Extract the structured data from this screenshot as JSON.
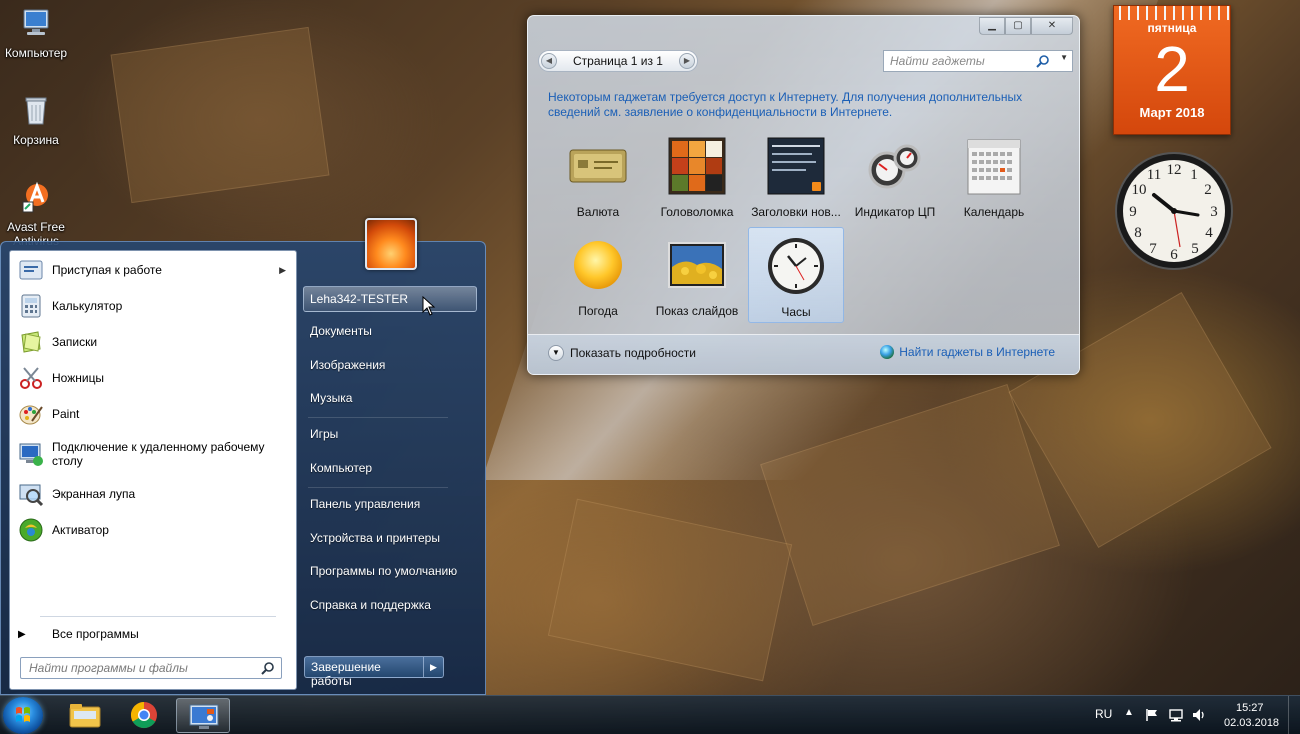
{
  "desktop": {
    "icons": [
      {
        "label": "Компьютер",
        "icon": "computer-icon"
      },
      {
        "label": "Корзина",
        "icon": "recycle-bin-icon"
      },
      {
        "label": "Avast Free Antivirus",
        "icon": "avast-icon"
      }
    ]
  },
  "start_menu": {
    "programs": [
      {
        "label": "Приступая к работе",
        "icon": "getting-started-icon",
        "has_submenu": true
      },
      {
        "label": "Калькулятор",
        "icon": "calculator-icon"
      },
      {
        "label": "Записки",
        "icon": "sticky-notes-icon"
      },
      {
        "label": "Ножницы",
        "icon": "snipping-tool-icon"
      },
      {
        "label": "Paint",
        "icon": "paint-icon"
      },
      {
        "label": "Подключение к удаленному рабочему столу",
        "icon": "remote-desktop-icon"
      },
      {
        "label": "Экранная лупа",
        "icon": "magnifier-icon"
      },
      {
        "label": "Активатор",
        "icon": "activator-icon"
      }
    ],
    "all_programs": "Все программы",
    "search_placeholder": "Найти программы и файлы",
    "user_name": "Leha342-TESTER",
    "right_items": [
      "Документы",
      "Изображения",
      "Музыка",
      "Игры",
      "Компьютер",
      "Панель управления",
      "Устройства и принтеры",
      "Программы по умолчанию",
      "Справка и поддержка"
    ],
    "shutdown_label": "Завершение работы"
  },
  "gadget_window": {
    "page_label": "Страница 1 из 1",
    "search_placeholder": "Найти гаджеты",
    "info_text": "Некоторым гаджетам требуется доступ к Интернету. Для получения дополнительных сведений см. заявление о конфиденциальности в Интернете.",
    "gadgets": [
      {
        "label": "Валюта",
        "icon": "currency-icon"
      },
      {
        "label": "Головоломка",
        "icon": "puzzle-icon"
      },
      {
        "label": "Заголовки нов...",
        "icon": "news-headlines-icon"
      },
      {
        "label": "Индикатор ЦП",
        "icon": "cpu-meter-icon"
      },
      {
        "label": "Календарь",
        "icon": "calendar-icon"
      },
      {
        "label": "Погода",
        "icon": "weather-icon"
      },
      {
        "label": "Показ слайдов",
        "icon": "slideshow-icon"
      },
      {
        "label": "Часы",
        "icon": "clock-icon",
        "selected": true
      }
    ],
    "show_details": "Показать подробности",
    "find_online": "Найти гаджеты в Интернете"
  },
  "calendar_gadget": {
    "weekday": "пятница",
    "day": "2",
    "month_year": "Март 2018"
  },
  "clock_gadget": {
    "time_shown": "10:21"
  },
  "taskbar": {
    "pinned": [
      "explorer-icon",
      "chrome-icon",
      "gadgets-icon"
    ],
    "language": "RU",
    "time": "15:27",
    "date": "02.03.2018"
  },
  "colors": {
    "link_blue": "#1b5fb6",
    "calendar_orange": "#e85a16",
    "start_menu_blue": "#284670"
  }
}
